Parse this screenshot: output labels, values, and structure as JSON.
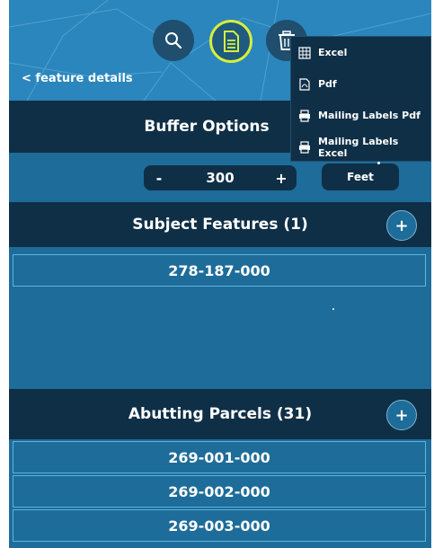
{
  "header": {
    "back_label": "< feature details"
  },
  "toolbar": {
    "search_icon": "search-icon",
    "document_icon": "document-icon",
    "trash_icon": "trash-icon"
  },
  "export_menu": {
    "items": [
      {
        "label": "Excel",
        "icon": "spreadsheet-icon"
      },
      {
        "label": "Pdf",
        "icon": "pdf-icon"
      },
      {
        "label": "Mailing Labels Pdf",
        "icon": "print-icon"
      },
      {
        "label": "Mailing Labels Excel",
        "icon": "print-icon"
      }
    ]
  },
  "buffer": {
    "title": "Buffer Options",
    "minus_label": "-",
    "value": "300",
    "plus_label": "+",
    "unit": "Feet"
  },
  "subject": {
    "title": "Subject Features (1)",
    "add_label": "+",
    "items": [
      "278-187-000"
    ]
  },
  "abutting": {
    "title": "Abutting Parcels (31)",
    "add_label": "+",
    "items": [
      "269-001-000",
      "269-002-000",
      "269-003-000"
    ]
  },
  "colors": {
    "panel": "#1d6c99",
    "dark_bar": "#0f2f47",
    "header": "#2a86bd",
    "active_ring": "#d6ef3a",
    "row_border": "#5fb4e0"
  }
}
